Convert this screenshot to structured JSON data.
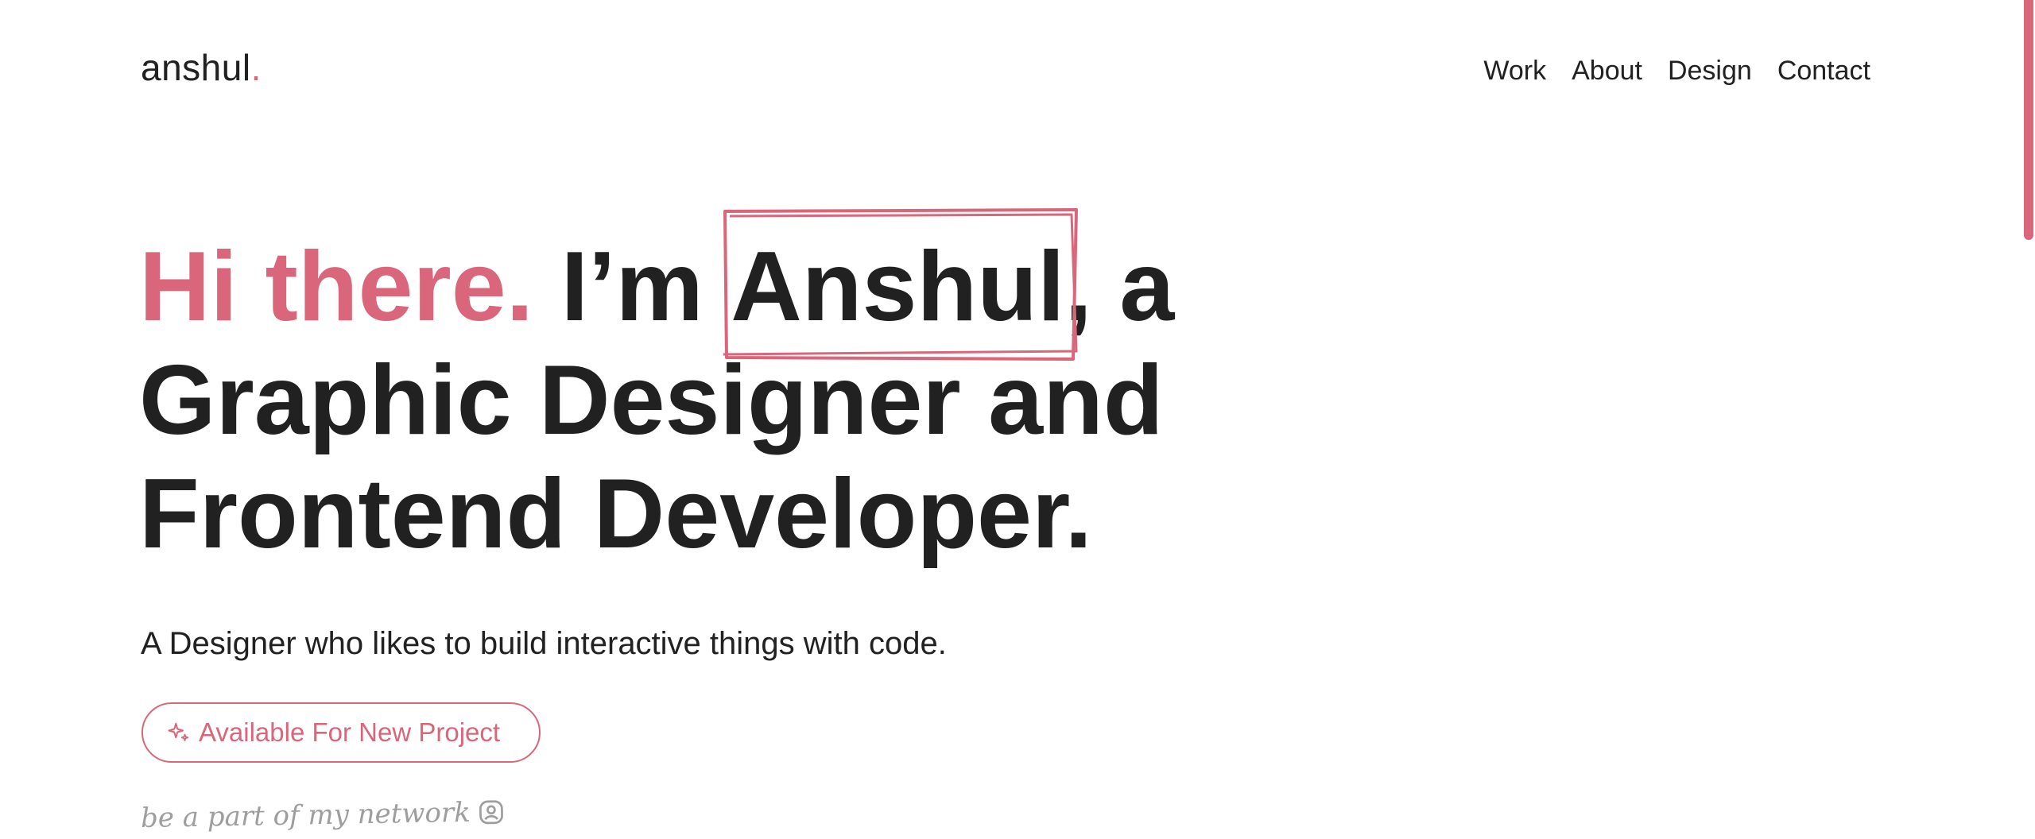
{
  "header": {
    "logo_text": "anshul",
    "logo_dot": ".",
    "nav": [
      {
        "label": "Work"
      },
      {
        "label": "About"
      },
      {
        "label": "Design"
      },
      {
        "label": "Contact"
      }
    ]
  },
  "hero": {
    "greeting": "Hi there.",
    "intro": "I’m",
    "name": "Anshul,",
    "after_name": "a",
    "line2": "Graphic Designer and",
    "line3": "Frontend Developer.",
    "tagline": "A Designer who likes to build interactive things with code.",
    "cta_label": "Available For New Project",
    "cta_icon": "sparkle-icon",
    "network_text": "be a part of my network",
    "network_icon": "user-badge-icon"
  },
  "colors": {
    "accent": "#d9667a",
    "text": "#212121",
    "muted": "#9e9e9e",
    "background": "#ffffff"
  }
}
